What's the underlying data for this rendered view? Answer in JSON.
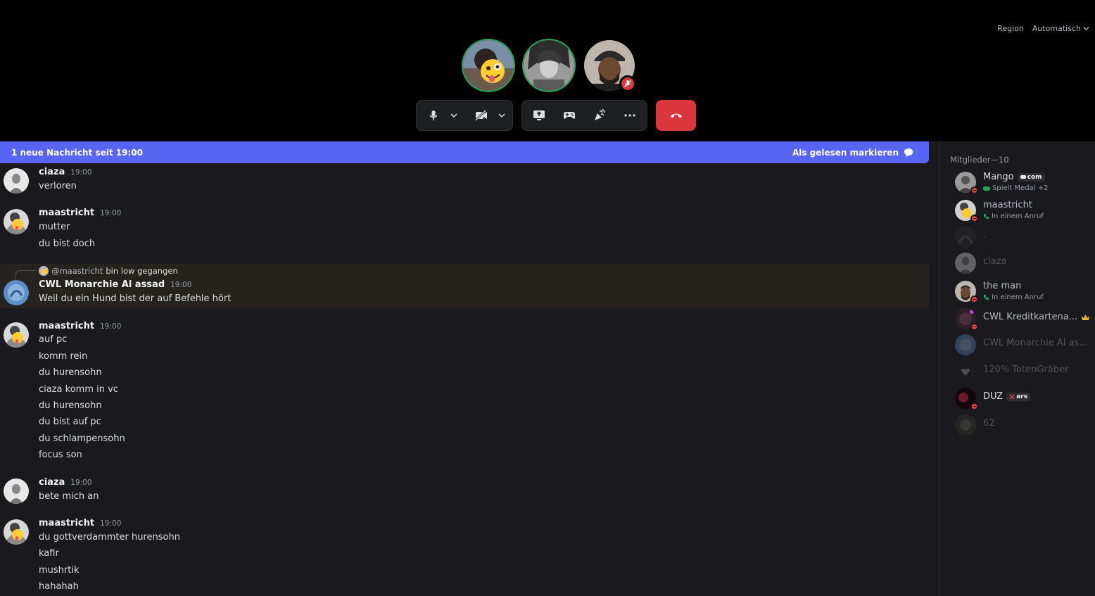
{
  "call": {
    "region_label": "Region",
    "region_value": "Automatisch",
    "participants": [
      {
        "name": "maastricht",
        "speaking": true
      },
      {
        "name": "ciaza",
        "speaking": true
      },
      {
        "name": "the man",
        "speaking": false,
        "muted": true
      }
    ],
    "controls": [
      "microphone",
      "microphone-options",
      "camera-off",
      "camera-options",
      "share-screen",
      "activities",
      "soundboard",
      "more",
      "disconnect"
    ]
  },
  "chat": {
    "new_messages_text": "1 neue Nachricht seit 19:00",
    "mark_read_label": "Als gelesen markieren",
    "messages": [
      {
        "author": "ciaza",
        "time": "19:00",
        "lines": [
          "verloren"
        ]
      },
      {
        "author": "maastricht",
        "time": "19:00",
        "lines": [
          "mutter",
          "du bist doch"
        ]
      },
      {
        "author": "CWL Monarchie Al assad",
        "time": "19:00",
        "reply_to": "@maastricht",
        "reply_text": "bin low gegangen",
        "lines": [
          "Weil du ein Hund bist der auf Befehle hört"
        ]
      },
      {
        "author": "maastricht",
        "time": "19:00",
        "lines": [
          "auf pc",
          "komm rein",
          "du hurensohn",
          "ciaza komm in vc",
          "du hurensohn",
          "du bist auf pc",
          "du schlampensohn",
          "focus son"
        ]
      },
      {
        "author": "ciaza",
        "time": "19:00",
        "lines": [
          "bete mich an"
        ]
      },
      {
        "author": "maastricht",
        "time": "19:00",
        "lines": [
          "du gottverdammter hurensohn",
          "kafir",
          "mushrtik",
          "hahahah"
        ]
      }
    ]
  },
  "members": {
    "header": "Mitglieder—10",
    "list": [
      {
        "name": "Mango",
        "tag": "com",
        "status": "Spielt Medal +2",
        "online": true
      },
      {
        "name": "maastricht",
        "status": "In einem Anruf",
        "online": true
      },
      {
        "name": ".",
        "online": false
      },
      {
        "name": "ciaza",
        "online": false
      },
      {
        "name": "the man",
        "status": "In einem Anruf",
        "online": true
      },
      {
        "name": "CWL Kreditkartena...",
        "online": true,
        "owner": true
      },
      {
        "name": "CWL Monarchie Al as...",
        "online": false
      },
      {
        "name": "120% TotenGräber",
        "online": false
      },
      {
        "name": "DUZ",
        "tag": "ars",
        "online": true
      },
      {
        "name": "62",
        "online": false
      }
    ]
  }
}
